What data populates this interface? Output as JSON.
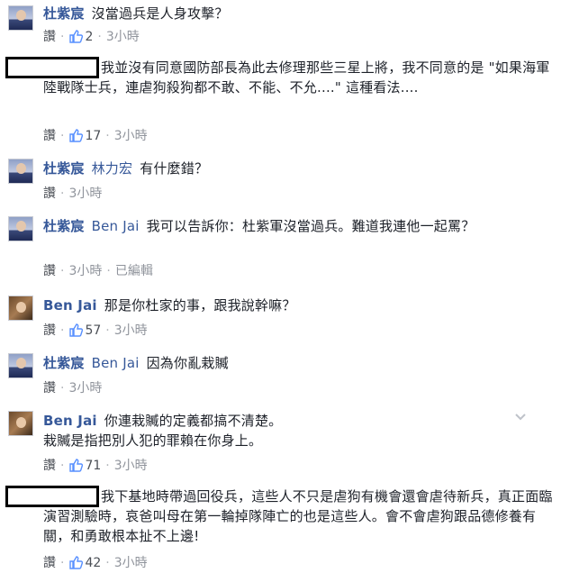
{
  "comments": [
    {
      "name": "杜紫宸",
      "tag": "",
      "text": "沒當過兵是人身攻擊？",
      "like_label": "讚",
      "likes": "2",
      "time": "3小時",
      "edited": ""
    },
    {
      "name": "",
      "tag": "",
      "text": "我並沒有同意國防部長為此去修理那些三星上將，我不同意的是 \"如果海軍陸戰隊士兵，連虐狗殺狗都不敢、不能、不允....\" 這種看法....",
      "like_label": "讚",
      "likes": "17",
      "time": "3小時",
      "edited": ""
    },
    {
      "name": "杜紫宸",
      "tag": "林力宏",
      "text": "有什麼錯？",
      "like_label": "讚",
      "likes": "",
      "time": "3小時",
      "edited": ""
    },
    {
      "name": "杜紫宸",
      "tag": "Ben Jai",
      "text": "我可以告訴你：杜紫軍沒當過兵。難道我連他一起罵？",
      "like_label": "讚",
      "likes": "",
      "time": "3小時",
      "edited": "已編輯"
    },
    {
      "name": "Ben Jai",
      "tag": "",
      "text": "那是你杜家的事，跟我說幹嘛？",
      "like_label": "讚",
      "likes": "57",
      "time": "3小時",
      "edited": ""
    },
    {
      "name": "杜紫宸",
      "tag": "Ben Jai",
      "text": "因為你亂栽贓",
      "like_label": "讚",
      "likes": "",
      "time": "3小時",
      "edited": ""
    },
    {
      "name": "Ben Jai",
      "tag": "",
      "text": "你連栽贓的定義都搞不清楚。",
      "text2": "栽贓是指把別人犯的罪賴在你身上。",
      "like_label": "讚",
      "likes": "71",
      "time": "3小時",
      "edited": ""
    },
    {
      "name": "",
      "tag": "",
      "text": "我下基地時帶過回役兵，這些人不只是虐狗有機會還會虐待新兵，真正面臨演習測驗時，哀爸叫母在第一輪掉隊陣亡的也是這些人。會不會虐狗跟品德修養有關，和勇敢根本扯不上邊!",
      "like_label": "讚",
      "likes": "42",
      "time": "3小時",
      "edited": ""
    }
  ],
  "icons": {
    "like": "thumbs-up-icon",
    "more": "chevron-down-icon"
  },
  "colors": {
    "link": "#365899",
    "meta": "#90949c",
    "like_blue": "#5890ff"
  }
}
